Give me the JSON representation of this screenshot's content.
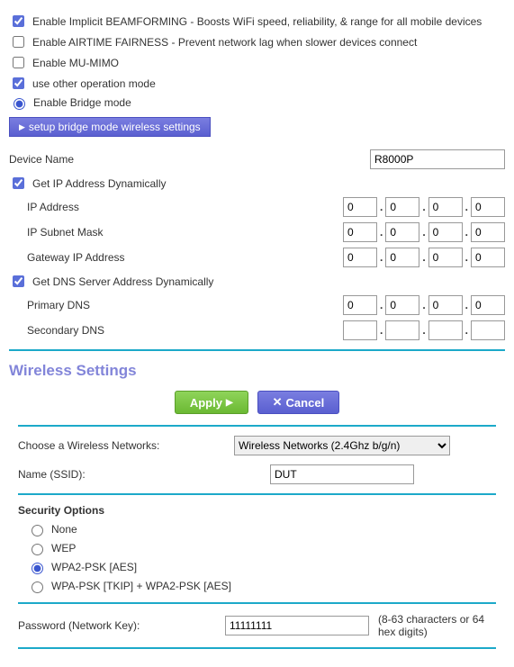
{
  "options": {
    "beamforming_label": "Enable Implicit BEAMFORMING - Boosts WiFi speed, reliability, & range for all mobile devices",
    "airtime_label": "Enable AIRTIME FAIRNESS - Prevent network lag when slower devices connect",
    "mumimo_label": "Enable MU-MIMO",
    "other_mode_label": "use other operation mode",
    "bridge_mode_label": "Enable Bridge mode",
    "setup_button": "setup bridge mode wireless settings"
  },
  "device": {
    "name_label": "Device Name",
    "name_value": "R8000P"
  },
  "ipdyn": {
    "label": "Get IP Address Dynamically",
    "ip_label": "IP Address",
    "ip": [
      "0",
      "0",
      "0",
      "0"
    ],
    "subnet_label": "IP Subnet Mask",
    "subnet": [
      "0",
      "0",
      "0",
      "0"
    ],
    "gateway_label": "Gateway IP Address",
    "gateway": [
      "0",
      "0",
      "0",
      "0"
    ]
  },
  "dnsdyn": {
    "label": "Get DNS Server Address Dynamically",
    "primary_label": "Primary DNS",
    "primary": [
      "0",
      "0",
      "0",
      "0"
    ],
    "secondary_label": "Secondary DNS",
    "secondary": [
      "",
      "",
      "",
      ""
    ]
  },
  "wireless": {
    "title": "Wireless Settings",
    "apply": "Apply",
    "cancel": "Cancel",
    "choose_label": "Choose a Wireless Networks:",
    "choose_value": "Wireless Networks (2.4Ghz b/g/n)",
    "ssid_label": "Name (SSID):",
    "ssid_value": "DUT",
    "security_title": "Security Options",
    "sec_none": "None",
    "sec_wep": "WEP",
    "sec_wpa2": "WPA2-PSK [AES]",
    "sec_wpa_mix": "WPA-PSK [TKIP] + WPA2-PSK [AES]",
    "pw_label": "Password (Network Key):",
    "pw_value": "11111111",
    "pw_hint": "(8-63 characters or 64 hex digits)"
  }
}
